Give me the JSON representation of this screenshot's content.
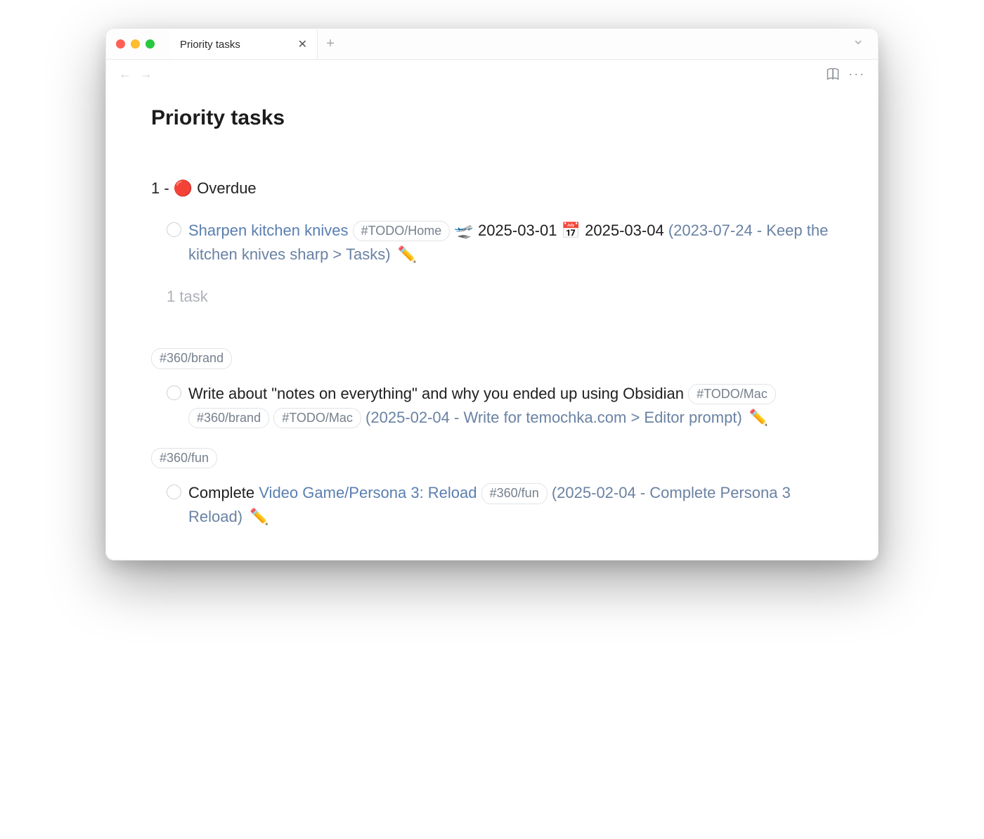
{
  "window": {
    "tab_title": "Priority tasks",
    "page_title": "Priority tasks"
  },
  "section1": {
    "heading": "1 - 🔴 Overdue",
    "task": {
      "title": "Sharpen kitchen knives",
      "tag": "#TODO/Home",
      "date_departure_emoji": "🛫",
      "date_departure": "2025-03-01",
      "date_calendar_emoji": "📅",
      "date_calendar": "2025-03-04",
      "source_text": "2023-07-24 - Keep the kitchen knives sharp > Tasks",
      "edit_icon": "✏️"
    },
    "count_text": "1 task"
  },
  "section2": {
    "tag_header": "#360/brand",
    "task": {
      "title": "Write about \"notes on everything\" and why you ended up using Obsidian",
      "tags": [
        "#TODO/Mac",
        "#360/brand",
        "#TODO/Mac"
      ],
      "source_text": "2025-02-04 - Write for temochka.com > Editor prompt",
      "edit_icon": "✏️"
    }
  },
  "section3": {
    "tag_header": "#360/fun",
    "task": {
      "prefix": "Complete",
      "linked_title": "Video Game/Persona 3: Reload",
      "tag": "#360/fun",
      "source_text": "2025-02-04 - Complete Persona 3 Reload",
      "edit_icon": "✏️"
    }
  }
}
